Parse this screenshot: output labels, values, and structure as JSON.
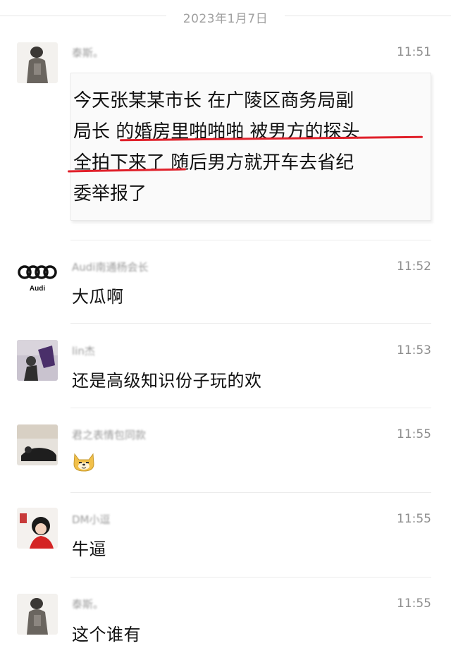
{
  "date_separator": "2023年1月7日",
  "messages": [
    {
      "sender": "泰斯。",
      "time": "11:51",
      "lines": [
        "今天张某某市长  在广陵区商务局副",
        "局长 的婚房里啪啪啪 被男方的探头",
        "全拍下来了 随后男方就开车去省纪",
        "委举报了"
      ]
    },
    {
      "sender": "Audi南通杨会长",
      "time": "11:52",
      "text": "大瓜啊"
    },
    {
      "sender": "lin杰",
      "time": "11:53",
      "text": "还是高级知识份子玩的欢"
    },
    {
      "sender": "君之表情包同款",
      "time": "11:55",
      "emoji": "doge-emoji"
    },
    {
      "sender": "DM小逗",
      "time": "11:55",
      "text": "牛逼"
    },
    {
      "sender": "泰斯。",
      "time": "11:55",
      "text": "这个谁有"
    }
  ],
  "audi_avatar_text": "Audi",
  "colors": {
    "underline": "#e0202a",
    "time": "#8e8e8e",
    "name": "#9a9a9a"
  }
}
